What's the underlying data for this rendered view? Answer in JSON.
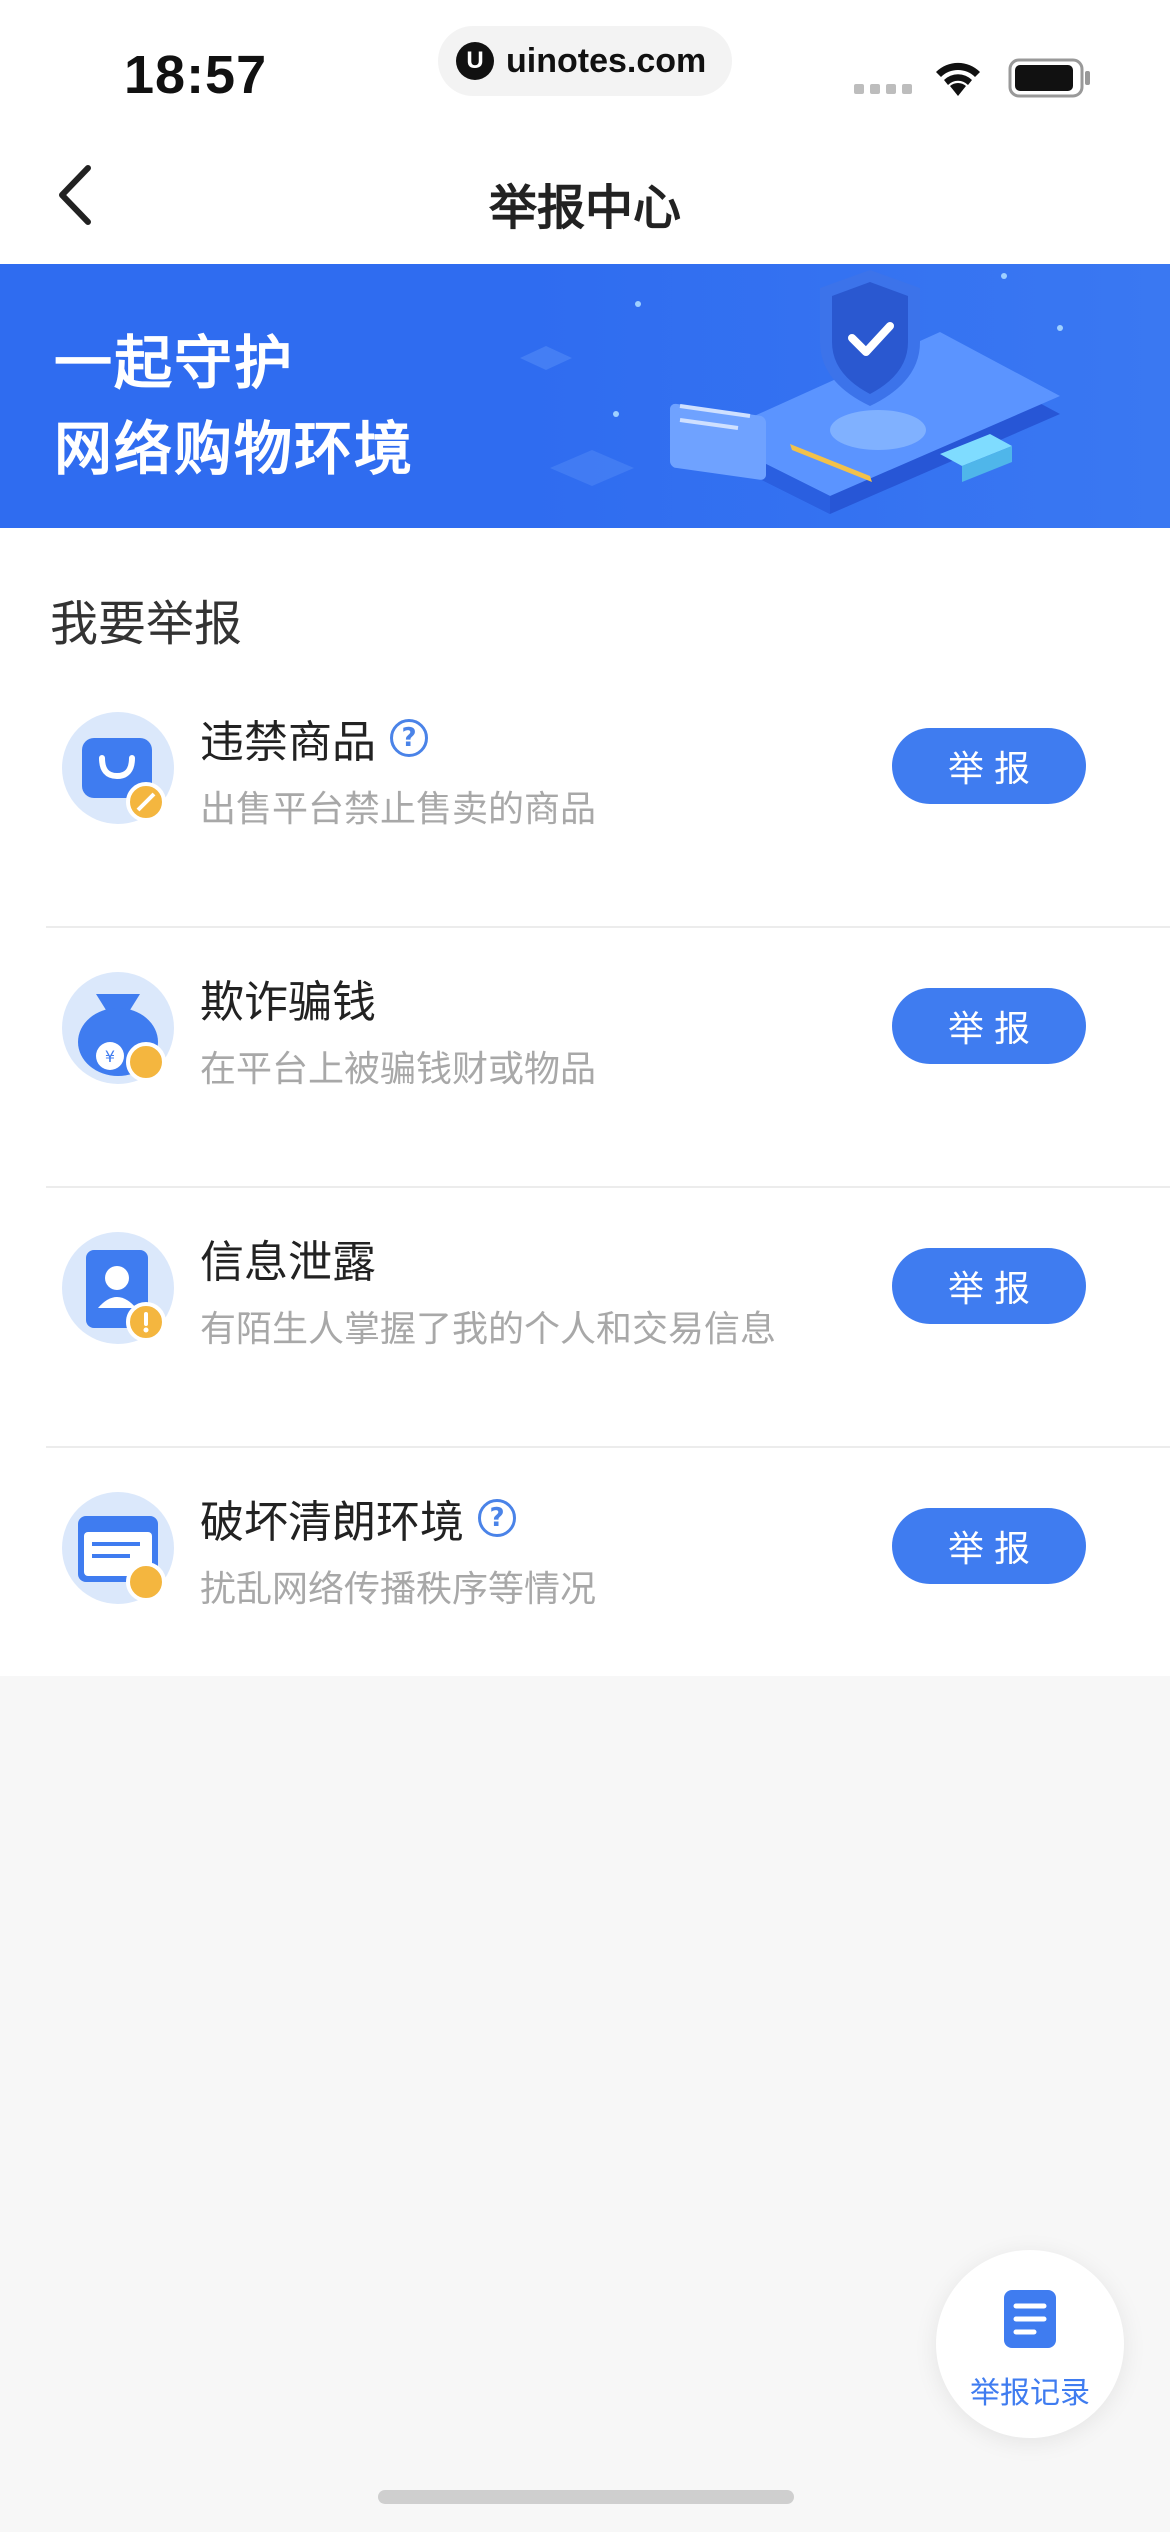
{
  "status_bar": {
    "time": "18:57",
    "url": "uinotes.com"
  },
  "nav": {
    "title": "举报中心"
  },
  "banner": {
    "line1": "一起守护",
    "line2": "网络购物环境"
  },
  "section": {
    "title": "我要举报"
  },
  "items": [
    {
      "title": "违禁商品",
      "desc": "出售平台禁止售卖的商品",
      "has_help": true,
      "button": "举报",
      "icon": "shopping-bag-icon"
    },
    {
      "title": "欺诈骗钱",
      "desc": "在平台上被骗钱财或物品",
      "has_help": false,
      "button": "举报",
      "icon": "money-bag-icon"
    },
    {
      "title": "信息泄露",
      "desc": "有陌生人掌握了我的个人和交易信息",
      "has_help": false,
      "button": "举报",
      "icon": "id-card-icon"
    },
    {
      "title": "破坏清朗环境",
      "desc": "扰乱网络传播秩序等情况",
      "has_help": true,
      "button": "举报",
      "icon": "web-page-icon"
    }
  ],
  "help_glyph": "?",
  "records": {
    "label": "举报记录"
  },
  "colors": {
    "accent": "#3f7cf0",
    "banner": "#2f6cf0"
  }
}
